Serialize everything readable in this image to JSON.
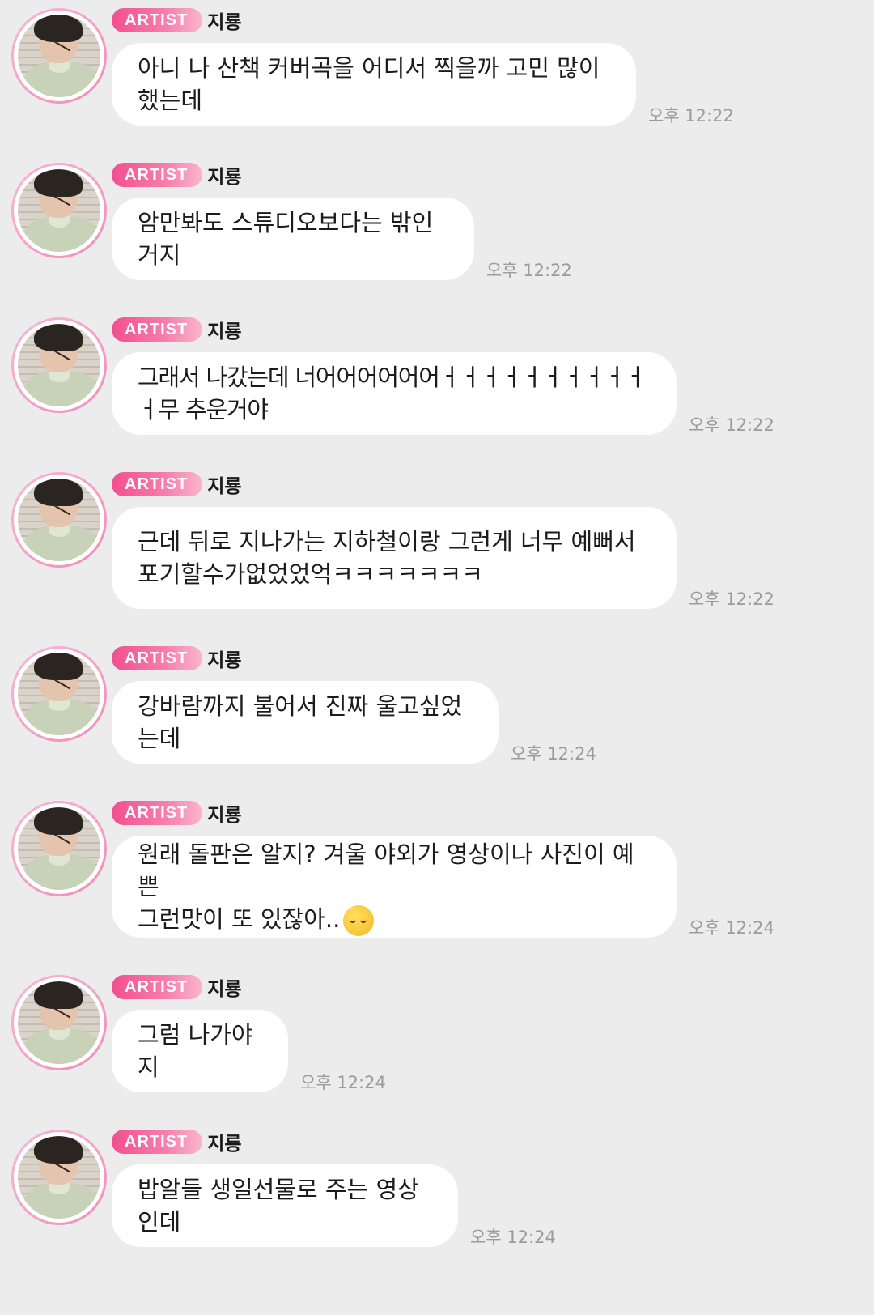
{
  "artist_badge": "ARTIST",
  "sender_name": "지룡",
  "messages": [
    {
      "text": "아니 나 산책 커버곡을 어디서 찍을까 고민 많이했는데",
      "time": "오후 12:22"
    },
    {
      "text": "암만봐도 스튜디오보다는 밖인거지",
      "time": "오후 12:22"
    },
    {
      "text": "그래서 나갔는데 너어어어어어어ㅓㅓㅓㅓㅓㅓㅓㅓㅓㅓㅓ무 추운거야",
      "time": "오후 12:22"
    },
    {
      "text": "근데 뒤로 지나가는 지하철이랑 그런게 너무 예뻐서\n포기할수가없었었억ㅋㅋㅋㅋㅋㅋㅋ",
      "time": "오후 12:22"
    },
    {
      "text": "강바람까지 불어서 진짜 울고싶었는데",
      "time": "오후 12:24"
    },
    {
      "text": "원래 돌판은 알지? 겨울 야외가 영상이나 사진이 예쁜\n그런맛이 또 있잖아..",
      "emoji": "relieved-face",
      "time": "오후 12:24"
    },
    {
      "text": "그럼 나가야지",
      "time": "오후 12:24"
    },
    {
      "text": "밥알들 생일선물로 주는 영상인데",
      "time": "오후 12:24"
    }
  ]
}
